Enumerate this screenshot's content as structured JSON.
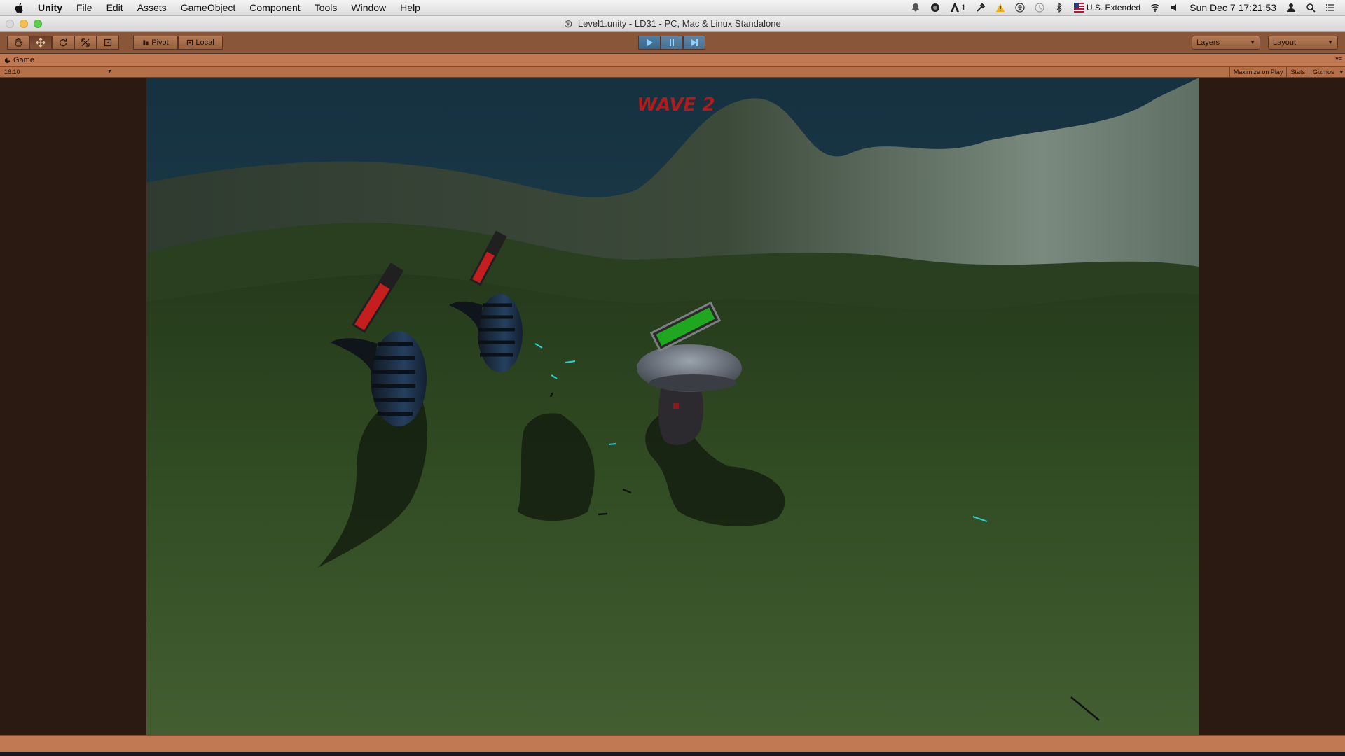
{
  "menubar": {
    "items": [
      "Unity",
      "File",
      "Edit",
      "Assets",
      "GameObject",
      "Component",
      "Tools",
      "Window",
      "Help"
    ],
    "status": {
      "adobe_badge": "1",
      "input_source": "U.S. Extended",
      "clock": "Sun Dec 7  17:21:53"
    }
  },
  "window": {
    "title": "Level1.unity - LD31 - PC, Mac & Linux Standalone"
  },
  "toolbar": {
    "tools": [
      "hand-icon",
      "move-icon",
      "rotate-icon",
      "scale-icon",
      "rect-icon"
    ],
    "selected_tool": "move-icon",
    "pivot_label": "Pivot",
    "local_label": "Local",
    "layers_label": "Layers",
    "layout_label": "Layout"
  },
  "game_panel": {
    "tab_label": "Game",
    "aspect": "16:10",
    "maximize_label": "Maximize on Play",
    "stats_label": "Stats",
    "gizmos_label": "Gizmos"
  },
  "scene": {
    "wave_text": "WAVE 2",
    "colors": {
      "sky": "#1d3b4a",
      "ground": "#3b5229",
      "enemy_health": "#c41e1e",
      "player_health": "#1fa81f",
      "wave_text": "#b31b1b"
    },
    "enemies": [
      {
        "name": "enemy-1",
        "health_fraction": 0.7
      },
      {
        "name": "enemy-2",
        "health_fraction": 0.6
      }
    ],
    "player": {
      "name": "mushroom",
      "health_fraction": 1.0
    }
  }
}
